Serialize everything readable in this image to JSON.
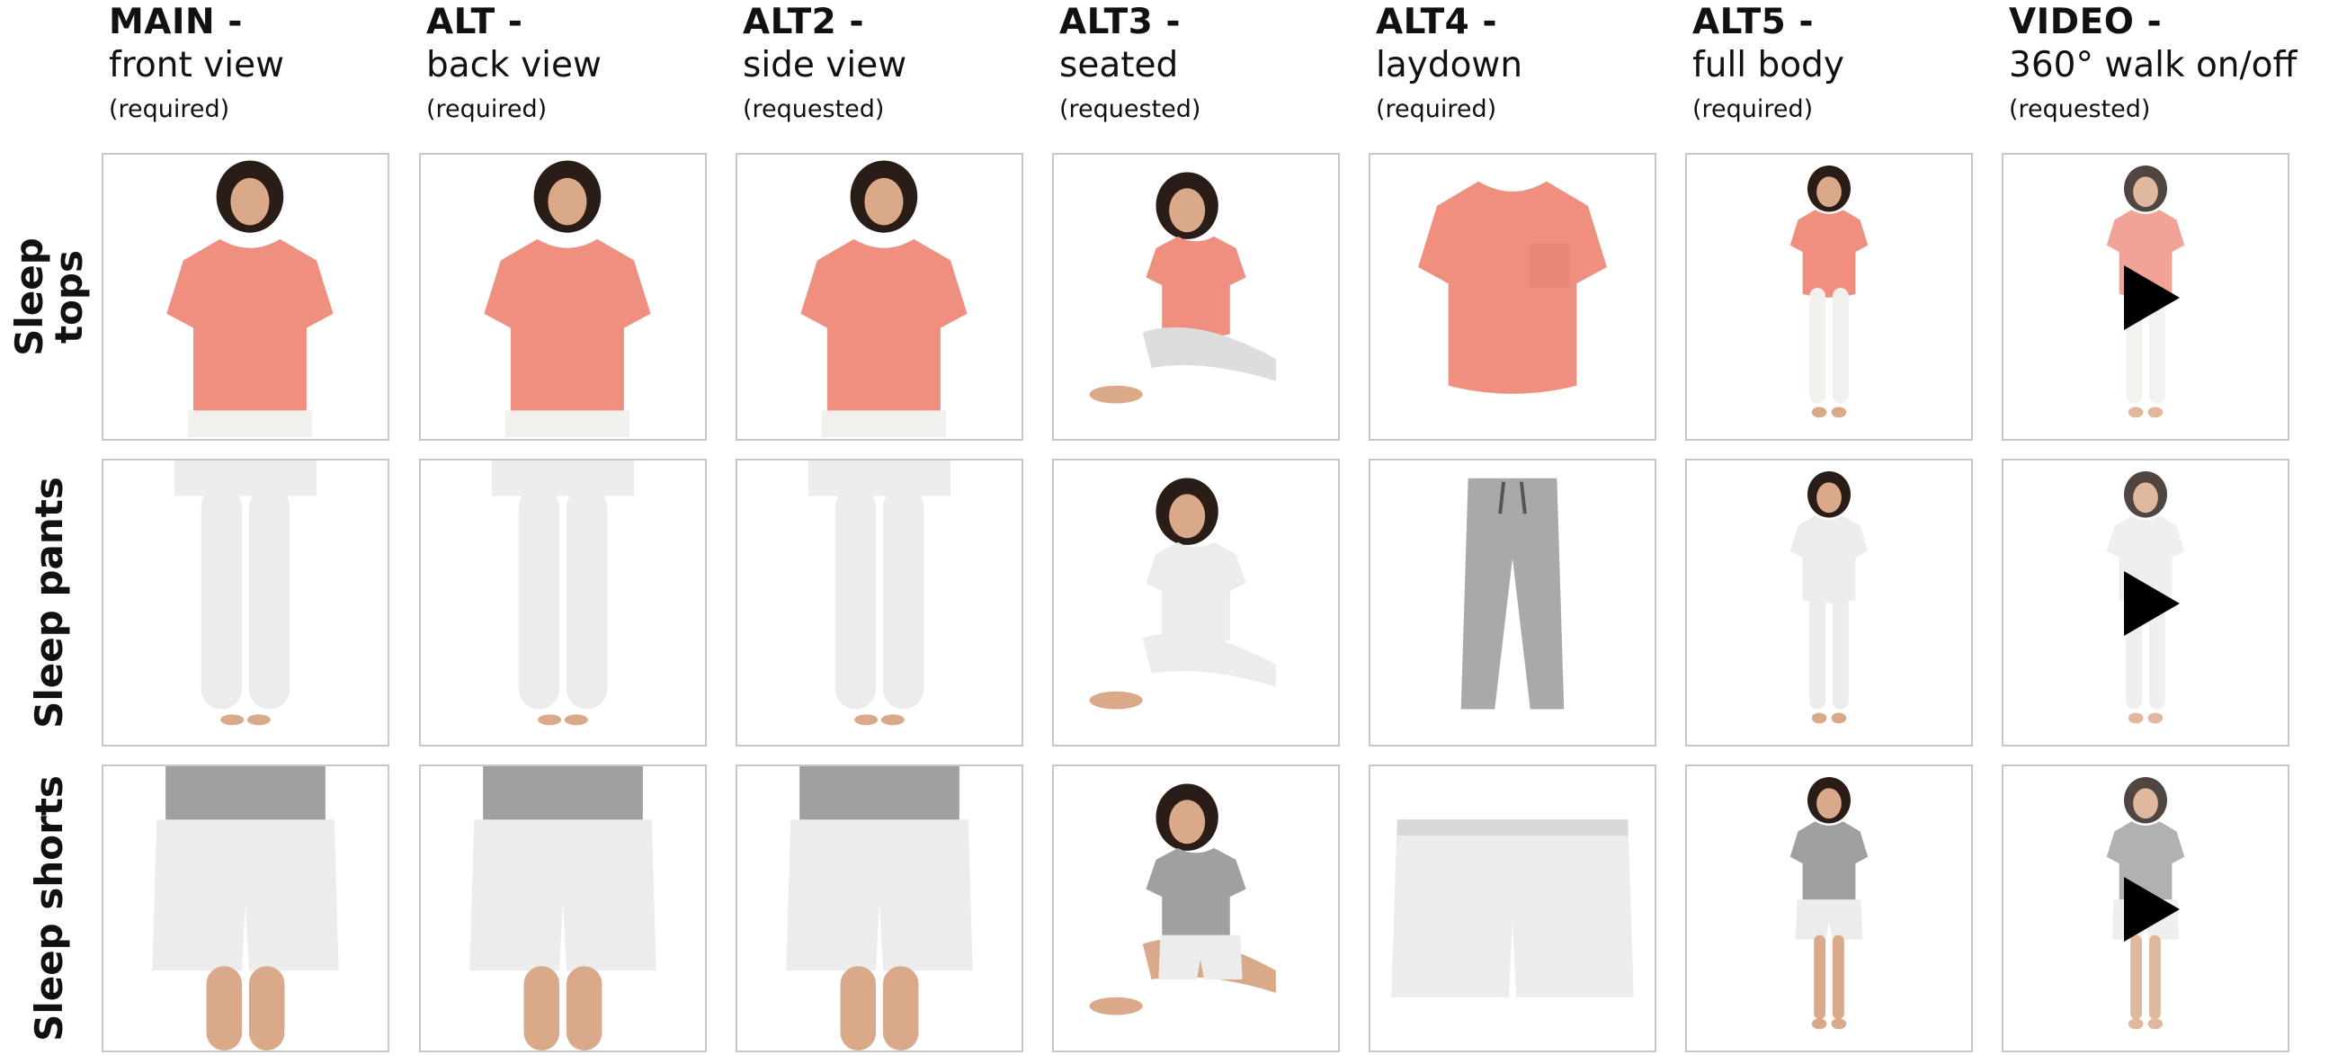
{
  "columns": [
    {
      "title": "MAIN -",
      "subtitle": "front view",
      "note": "(required)"
    },
    {
      "title": "ALT -",
      "subtitle": "back view",
      "note": "(required)"
    },
    {
      "title": "ALT2 -",
      "subtitle": "side view",
      "note": "(requested)"
    },
    {
      "title": "ALT3 -",
      "subtitle": "seated",
      "note": "(requested)"
    },
    {
      "title": "ALT4 -",
      "subtitle": "laydown",
      "note": "(required)"
    },
    {
      "title": "ALT5 -",
      "subtitle": "full body",
      "note": "(required)"
    },
    {
      "title": "VIDEO -",
      "subtitle": "360° walk on/off",
      "note": "(requested)"
    }
  ],
  "rows": [
    {
      "label_line1": "Sleep",
      "label_line2": "tops",
      "product": "pink-tee"
    },
    {
      "label_line1": "Sleep pants",
      "label_line2": "",
      "product": "grey-joggers"
    },
    {
      "label_line1": "Sleep shorts",
      "label_line2": "",
      "product": "grey-shorts"
    }
  ],
  "colors": {
    "coral": "#ef8f80",
    "coral_dark": "#d97465",
    "heather_light": "#ececec",
    "heather_mid": "#a9a9a9",
    "grey_top": "#a0a0a0",
    "skin": "#d9a989",
    "hair": "#2a1d17",
    "play": "#000000",
    "frame": "#c8c8c8"
  },
  "icons": {
    "video_play": "play-icon"
  }
}
